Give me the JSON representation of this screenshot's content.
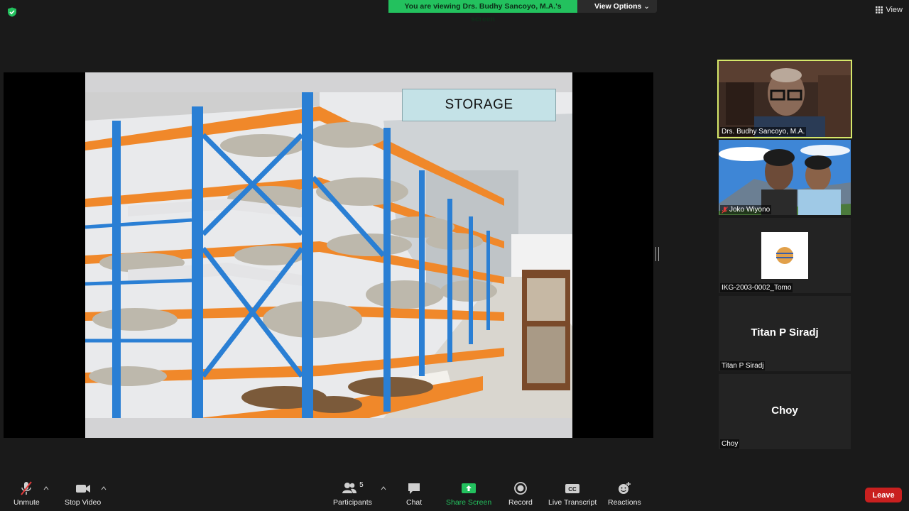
{
  "banner": {
    "message": "You are viewing Drs. Budhy Sancoyo, M.A.'s screen",
    "view_options": "View Options"
  },
  "view_button": "View",
  "slide": {
    "label": "STORAGE"
  },
  "participants_panel": [
    {
      "name": "Drs. Budhy Sancoyo, M.A.",
      "type": "video",
      "active": true,
      "muted": false
    },
    {
      "name": "Joko Wiyono",
      "type": "video",
      "active": false,
      "muted": true
    },
    {
      "name": "IKG-2003-0002_Tomo",
      "type": "avatar",
      "active": false,
      "muted": false
    },
    {
      "name": "Titan P Siradj",
      "type": "name",
      "display": "Titan P Siradj"
    },
    {
      "name": "Choy",
      "type": "name",
      "display": "Choy"
    }
  ],
  "toolbar": {
    "unmute": "Unmute",
    "stop_video": "Stop Video",
    "participants": "Participants",
    "participants_count": "5",
    "chat": "Chat",
    "share_screen": "Share Screen",
    "record": "Record",
    "live_transcript": "Live Transcript",
    "reactions": "Reactions",
    "leave": "Leave"
  },
  "colors": {
    "share_green": "#23c15e",
    "leave_red": "#c9201f",
    "active_speaker": "#d6e86a",
    "shelf_orange": "#f0882a",
    "shelf_blue": "#2a7fd4"
  }
}
